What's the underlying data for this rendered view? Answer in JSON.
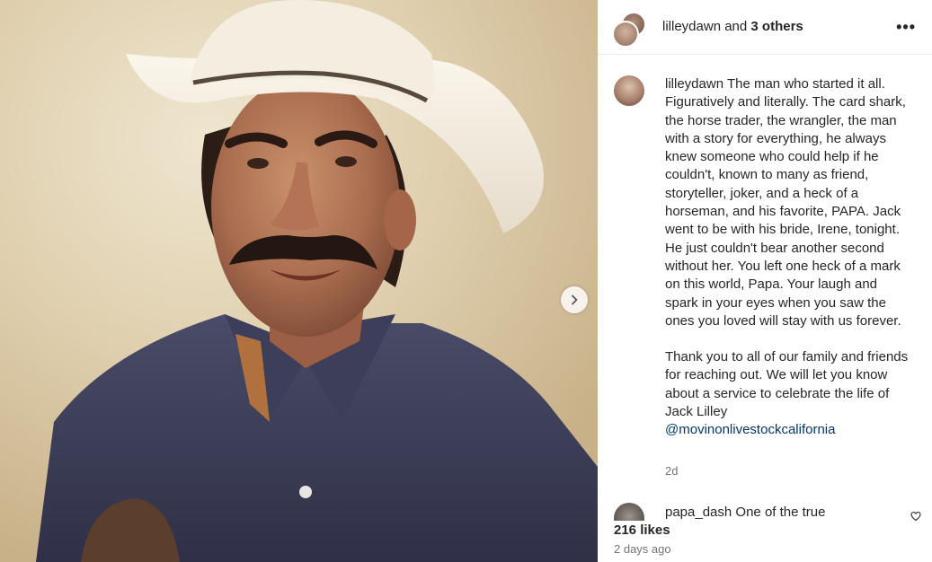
{
  "header": {
    "username": "lilleydawn",
    "connector": " and ",
    "others": "3 others",
    "more_icon": "more-horizontal-icon",
    "more_label": "•••"
  },
  "photo": {
    "alt_subject": "photo",
    "next_icon": "chevron-right-icon"
  },
  "caption": {
    "username": "lilleydawn",
    "paragraph1": "The man who started it all. Figuratively and literally. The card shark, the horse trader, the wrangler, the man with a story for everything, he always knew someone who could help if he couldn't, known to many as friend, storyteller, joker, and a heck of a horseman, and his favorite, PAPA. Jack went to be with his bride, Irene, tonight. He just couldn't bear another second without her. You left one heck of a mark on this world, Papa. Your laugh and spark in your eyes when you saw the ones you loved will stay with us forever.",
    "paragraph2": "Thank you to all of our family and friends for reaching out. We will let you know about a service to celebrate the life of Jack Lilley",
    "mention": "@movinonlivestockcalifornia",
    "time_ago": "2d"
  },
  "comment": {
    "username": "papa_dash",
    "text": "One of the true"
  },
  "likes": "216 likes",
  "date": "2 days ago",
  "colors": {
    "mention": "#00376b",
    "secondary_text": "#737373",
    "primary_text": "#262626"
  }
}
